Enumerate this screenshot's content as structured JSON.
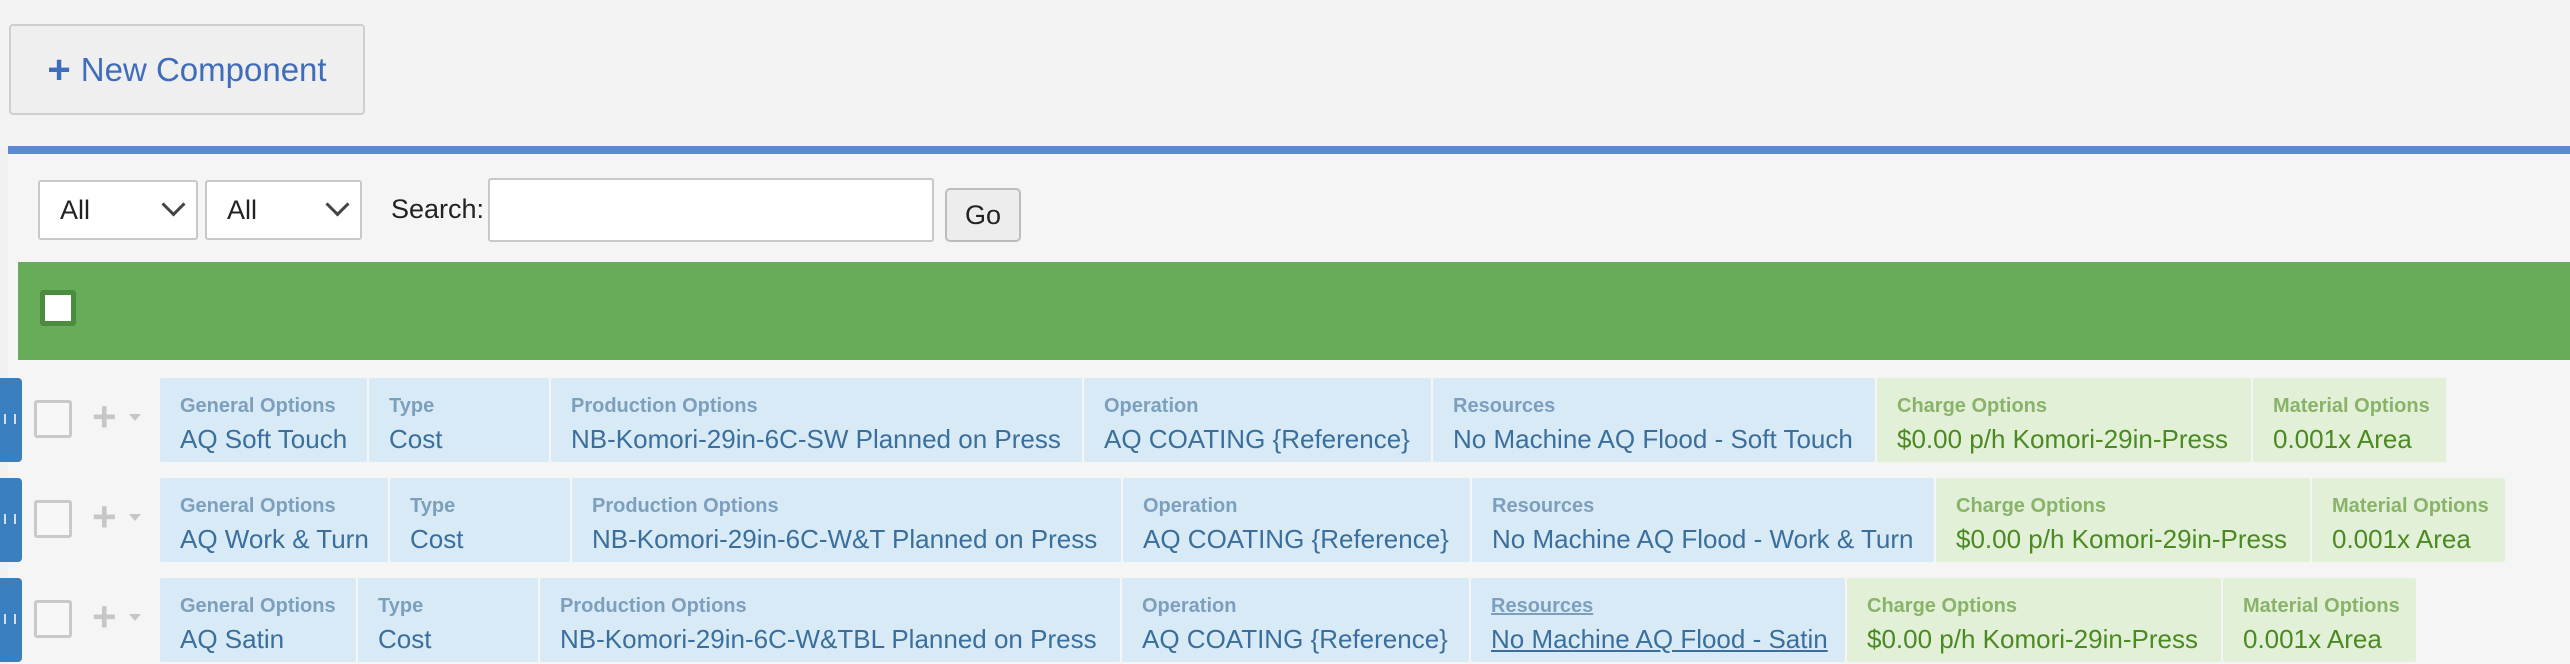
{
  "toolbar": {
    "new_component_label": "New Component"
  },
  "filters": {
    "select1_value": "All",
    "select2_value": "All",
    "search_label": "Search:",
    "search_value": "",
    "go_label": "Go"
  },
  "rows": [
    {
      "general": {
        "label": "General Options",
        "value": "AQ Soft Touch"
      },
      "type": {
        "label": "Type",
        "value": "Cost"
      },
      "production": {
        "label": "Production Options",
        "value": "NB-Komori-29in-6C-SW Planned on Press"
      },
      "operation": {
        "label": "Operation",
        "value": "AQ COATING {Reference}"
      },
      "resources": {
        "label": "Resources",
        "value": "No Machine AQ Flood - Soft Touch"
      },
      "charge": {
        "label": "Charge Options",
        "value": "$0.00 p/h Komori-29in-Press"
      },
      "material": {
        "label": "Material Options",
        "value": "0.001x Area"
      }
    },
    {
      "general": {
        "label": "General Options",
        "value": "AQ Work & Turn"
      },
      "type": {
        "label": "Type",
        "value": "Cost"
      },
      "production": {
        "label": "Production Options",
        "value": "NB-Komori-29in-6C-W&T Planned on Press"
      },
      "operation": {
        "label": "Operation",
        "value": "AQ COATING {Reference}"
      },
      "resources": {
        "label": "Resources",
        "value": "No Machine AQ Flood - Work & Turn"
      },
      "charge": {
        "label": "Charge Options",
        "value": "$0.00 p/h Komori-29in-Press"
      },
      "material": {
        "label": "Material Options",
        "value": "0.001x Area"
      }
    },
    {
      "general": {
        "label": "General Options",
        "value": "AQ Satin"
      },
      "type": {
        "label": "Type",
        "value": "Cost"
      },
      "production": {
        "label": "Production Options",
        "value": "NB-Komori-29in-6C-W&TBL Planned on Press"
      },
      "operation": {
        "label": "Operation",
        "value": "AQ COATING {Reference}"
      },
      "resources": {
        "label": "Resources",
        "value": "No Machine AQ Flood - Satin"
      },
      "charge": {
        "label": "Charge Options",
        "value": "$0.00 p/h Komori-29in-Press"
      },
      "material": {
        "label": "Material Options",
        "value": "0.001x Area"
      }
    }
  ],
  "colors": {
    "accent_blue": "#5b89d6",
    "header_green": "#67ad59",
    "cell_blue": "#d8eaf5",
    "cell_green": "#e1f0d6"
  }
}
